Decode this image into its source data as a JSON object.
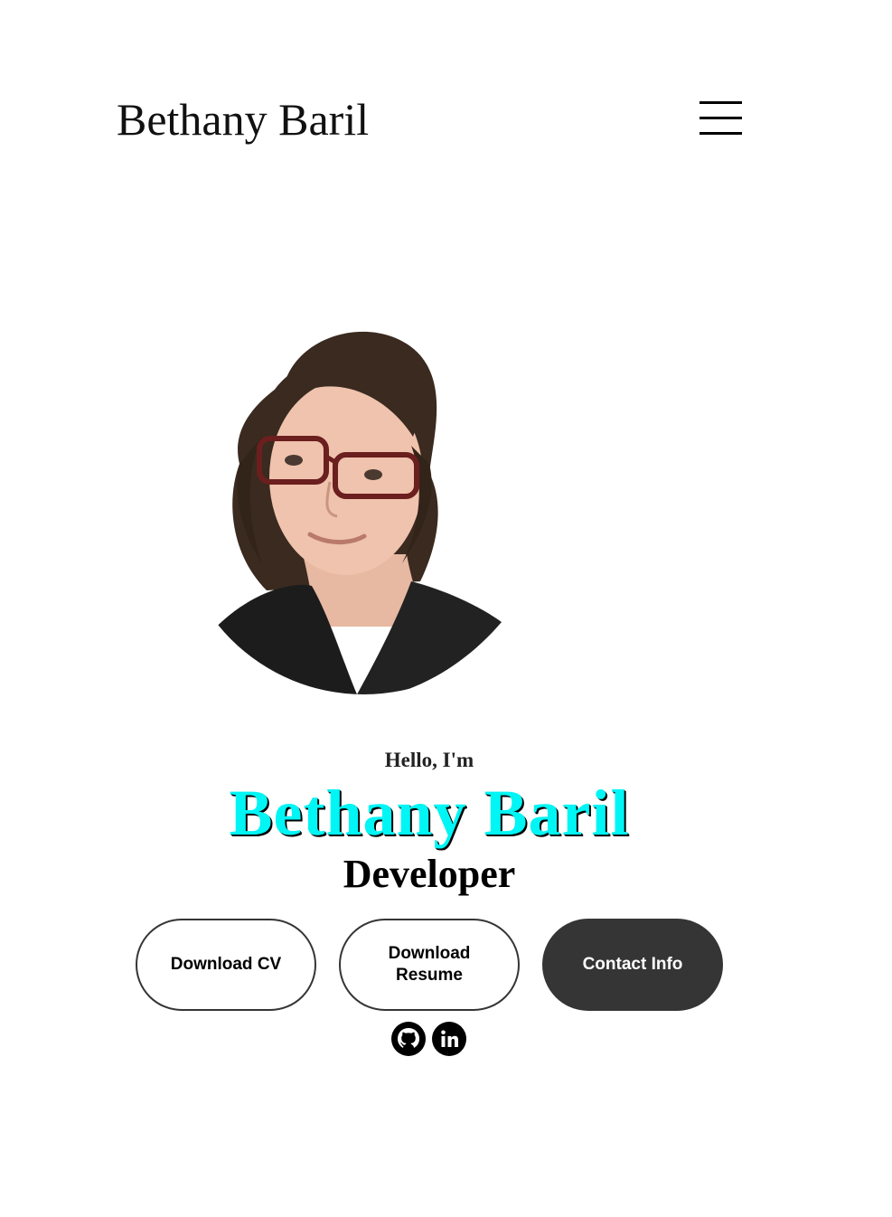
{
  "header": {
    "logo_text": "Bethany Baril",
    "menu_icon": "hamburger-menu-icon"
  },
  "profile": {
    "greeting": "Hello, I'm",
    "name": "Bethany Baril",
    "role": "Developer",
    "photo_alt": "Bethany Baril profile picture"
  },
  "buttons": {
    "download_cv": "Download CV",
    "download_resume": "Download Resume",
    "contact_info": "Contact Info"
  },
  "socials": [
    {
      "icon": "github-icon"
    },
    {
      "icon": "linkedin-icon"
    }
  ],
  "colors": {
    "name_accent": "#00f5f5",
    "button_dark": "#353535",
    "text": "#000000",
    "background": "#ffffff"
  }
}
